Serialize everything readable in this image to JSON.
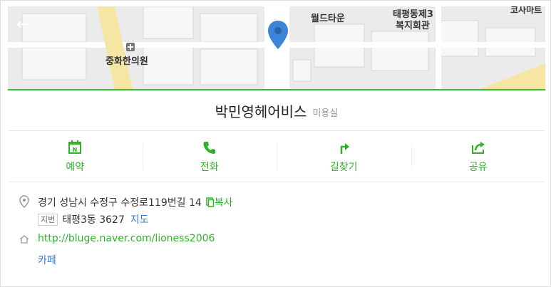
{
  "map": {
    "labels": {
      "worldtown": "월드타운",
      "taepyeong_welfare_line1": "태평동제3",
      "taepyeong_welfare_line2": "복지회관",
      "clinic": "중화한의원",
      "corner": "코사마트"
    }
  },
  "place": {
    "name": "박민영헤어비스",
    "category": "미용실"
  },
  "actions": [
    {
      "label": "예약",
      "icon": "calendar-icon"
    },
    {
      "label": "전화",
      "icon": "phone-icon"
    },
    {
      "label": "길찾기",
      "icon": "directions-icon"
    },
    {
      "label": "공유",
      "icon": "share-icon"
    }
  ],
  "address": {
    "road": "경기 성남시 수정구 수정로119번길 14",
    "copy_label": "복사",
    "jibun_badge": "지번",
    "jibun": "태평3동 3627",
    "map_link": "지도"
  },
  "website": {
    "url": "http://bluge.naver.com/lioness2006",
    "cafe": "카페"
  },
  "colors": {
    "accent": "#2fb12a",
    "link_blue": "#2f7bd6",
    "pin": "#3b84d8"
  }
}
